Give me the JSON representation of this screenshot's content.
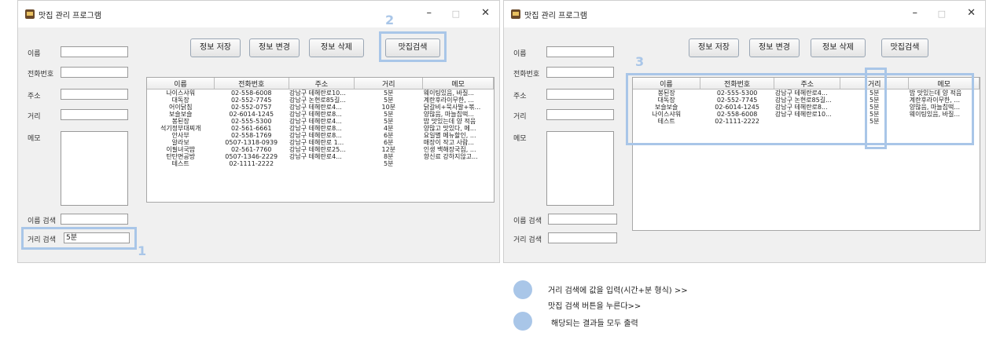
{
  "window_title": "맛집 관리 프로그램",
  "window_controls": {
    "min": "–",
    "max": "□",
    "close": "✕"
  },
  "labels": {
    "name": "이름",
    "phone": "전화번호",
    "address": "주소",
    "distance": "거리",
    "memo": "메모",
    "name_search": "이름 검색",
    "distance_search": "거리 검색"
  },
  "buttons": {
    "save": "정보 저장",
    "edit": "정보 변경",
    "delete": "정보 삭제",
    "search": "맛집검색"
  },
  "columns": [
    "이름",
    "전화번호",
    "주소",
    "거리",
    "메모"
  ],
  "left": {
    "distance_search_value": "5분",
    "rows": [
      [
        "나이스샤워",
        "02-558-6008",
        "강남구 테헤란로10...",
        "5분",
        "웨이팅있음, 바질..."
      ],
      [
        "대독장",
        "02-552-7745",
        "강남구 논현로85길...",
        "5분",
        "계란후라이무한, ..."
      ],
      [
        "어이닭침",
        "02-552-0757",
        "강남구 테헤란로4...",
        "10분",
        "닭갈비+묵사발+볶..."
      ],
      [
        "보슬보슬",
        "02-6014-1245",
        "강남구 테헤란로8...",
        "5분",
        "양많음, 마늘칩떡..."
      ],
      [
        "봉된장",
        "02-555-5300",
        "강남구 테헤란로4...",
        "5분",
        "밥 맛있는데 양 적음"
      ],
      [
        "석기정부대찌개",
        "02-561-6661",
        "강남구 테헤란로8...",
        "4분",
        "양많고 맛있다, 메..."
      ],
      [
        "안사부",
        "02-558-1769",
        "강남구 테헤란로8...",
        "6분",
        "요일별 메뉴할인, ..."
      ],
      [
        "알라보",
        "0507-1318-0939",
        "강남구 테헤란로 1...",
        "6분",
        "매장이 작고 사람..."
      ],
      [
        "이필녀국밥",
        "02-561-7760",
        "강남구 테헤란로25...",
        "12분",
        "인생 백해장국집, ..."
      ],
      [
        "탄탄면공방",
        "0507-1346-2229",
        "강남구 테헤란로4...",
        "8분",
        "향신료 강하지않고..."
      ],
      [
        "테스트",
        "02-1111-2222",
        "",
        "5분",
        ""
      ]
    ]
  },
  "right": {
    "rows": [
      [
        "봉된장",
        "02-555-5300",
        "강남구 테헤란로4...",
        "5분",
        "밥 맛있는데 양 적음"
      ],
      [
        "대독장",
        "02-552-7745",
        "강남구 논현로85길...",
        "5분",
        "계란후라이무한, ..."
      ],
      [
        "보슬보슬",
        "02-6014-1245",
        "강남구 테헤란로8...",
        "5분",
        "양많음, 마늘칩떡..."
      ],
      [
        "나이스샤워",
        "02-558-6008",
        "강남구 테헤란로10...",
        "5분",
        "웨이팅있음, 바질..."
      ],
      [
        "테스트",
        "02-1111-2222",
        "",
        "5분",
        ""
      ]
    ]
  },
  "markers": {
    "one": "1",
    "two": "2",
    "three": "3"
  },
  "notes": [
    "거리 검색에 값을 입력(시간+분 형식) >>",
    "맛집 검색 버튼을 누른다>>",
    "해당되는 결과들 모두 출력"
  ],
  "colors": {
    "highlight": "#a9c6e8"
  }
}
